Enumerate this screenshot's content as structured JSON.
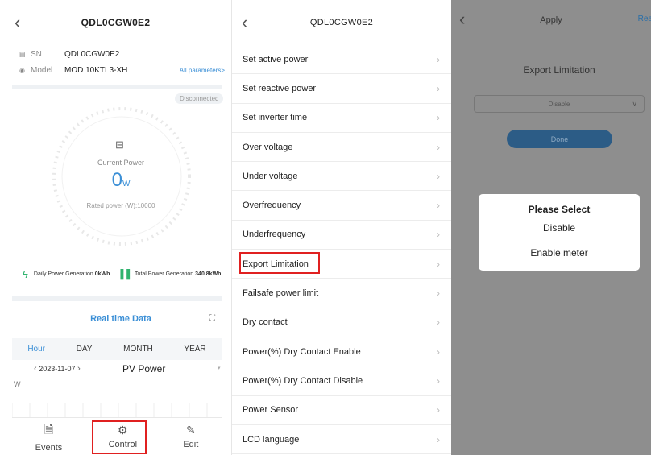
{
  "panel1": {
    "title": "QDL0CGW0E2",
    "sn_label": "SN",
    "sn_value": "QDL0CGW0E2",
    "model_label": "Model",
    "model_value": "MOD 10KTL3-XH",
    "all_params": "All parameters>",
    "status": "Disconnected",
    "current_power_label": "Current Power",
    "current_power_value": "0",
    "current_power_unit": "W",
    "rated_power": "Rated power (W):10000",
    "daily_label": "Daily Power Generation",
    "daily_value": "0kWh",
    "total_label": "Total Power Generation",
    "total_value": "340.8kWh",
    "realtime_title": "Real time Data",
    "tabs": [
      "Hour",
      "DAY",
      "MONTH",
      "YEAR"
    ],
    "date": "2023-11-07",
    "series_select": "PV Power",
    "y_unit": "W",
    "nav": [
      {
        "label": "Events",
        "icon": "events-icon"
      },
      {
        "label": "Control",
        "icon": "control-gear-icon"
      },
      {
        "label": "Edit",
        "icon": "edit-icon"
      }
    ]
  },
  "panel2": {
    "title": "QDL0CGW0E2",
    "items": [
      "Set active power",
      "Set reactive power",
      "Set inverter time",
      "Over voltage",
      "Under voltage",
      "Overfrequency",
      "Underfrequency",
      "Export Limitation",
      "Failsafe power limit",
      "Dry contact",
      "Power(%) Dry Contact Enable",
      "Power(%) Dry Contact Disable",
      "Power Sensor",
      "LCD language"
    ]
  },
  "panel3": {
    "title": "Apply",
    "right_action": "Rea",
    "section_title": "Export Limitation",
    "select_value": "Disable",
    "done_button": "Done",
    "dialog_title": "Please Select",
    "options": [
      "Disable",
      "Enable meter"
    ]
  },
  "colors": {
    "accent": "#3b8fd6",
    "highlight": "#e02020",
    "overlay": "#8e8e8e"
  }
}
